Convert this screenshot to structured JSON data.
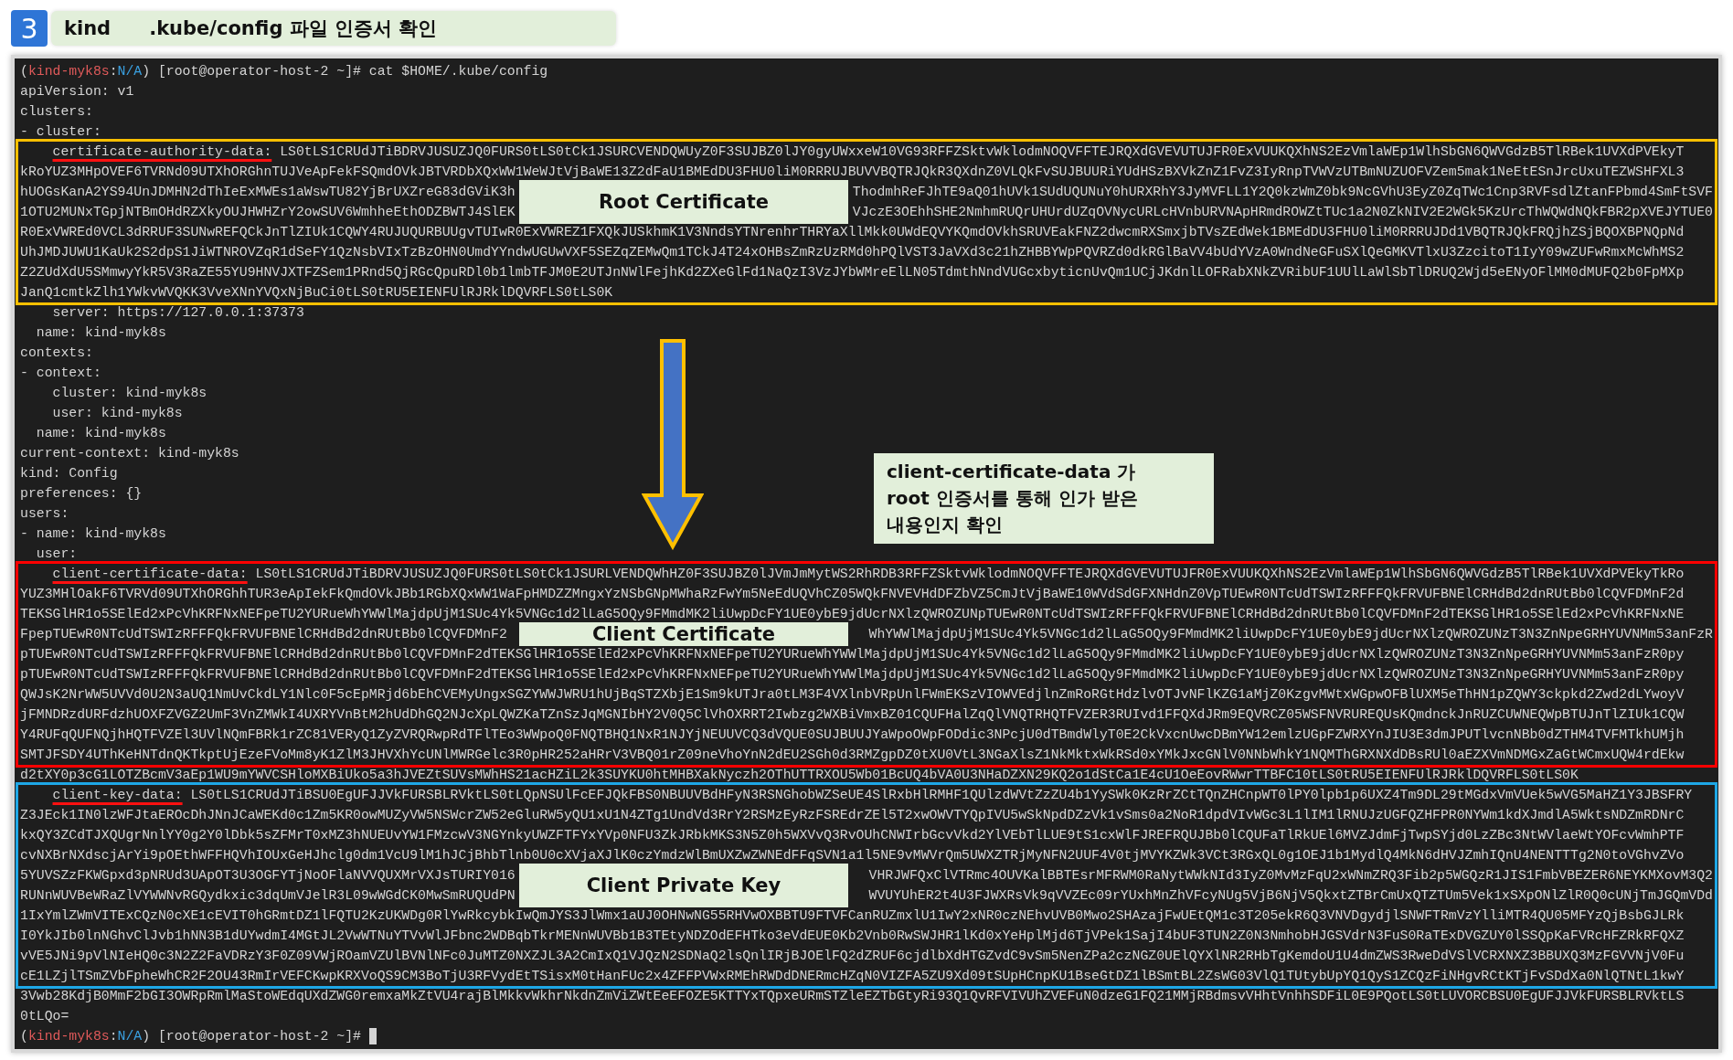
{
  "header": {
    "step": "3",
    "title_parts": [
      "kind",
      ".kube/config 파일 인증서 확인"
    ]
  },
  "terminal": {
    "sections": [
      {
        "kind": "plain",
        "lines": [
          {
            "kind": "prompt",
            "segments": [
              {
                "text": "(",
                "color": "#d4d4d4"
              },
              {
                "text": "kind-myk8s",
                "color": "#e05a5a"
              },
              {
                "text": ":",
                "color": "#d4d4d4"
              },
              {
                "text": "N/A",
                "color": "#3aa0e0"
              },
              {
                "text": ") [root@operator-host-2 ~]# cat $HOME/.kube/config",
                "color": "#d4d4d4"
              }
            ],
            "cursor": false
          },
          {
            "kind": "text",
            "text": "apiVersion: v1"
          },
          {
            "kind": "text",
            "text": "clusters:"
          },
          {
            "kind": "text",
            "text": "- cluster:"
          }
        ]
      },
      {
        "kind": "box",
        "color": "#ffc000",
        "label": "Root Certificate",
        "lines": [
          {
            "kind": "key",
            "key": "certificate-authority-data:",
            "value": "LS0tLS1CRUdJTiBDRVJUSUZJQ0FURS0tLS0tCk1JSURCVENDQWUyZ0F3SUJBZ0lJY0gyUWxxeW10VG93RFFZSktvWklodmNOQVFFTEJRQXdGVEVUTUJFR0ExVUUKQXhNS2EzVmlaWEp1WlhSbGN6QWVGdzB5TlRBek1UVXdPVEkyT"
          },
          {
            "kind": "text",
            "text": "kRoYUZ3MHpOVEF6TVRNd09UTXhORGhnTUJVeApFekFSQmdOVkJBTVRDbXQxWW1WeWJtVjBaWE13Z2dFaU1BMEdDU3FHU0liM0RRRUJBUVVBQTRJQkR3QXdnZ0VLQkFvSUJBUURiYUdHSzBXVkZnZ1FvZ3IyRnpTVWVzUTBmNUZUOFVZem5mak1NeEtESnJrcUxuTEZWSHFXL3"
          },
          {
            "kind": "split",
            "left": "hUOGsKanA2YS94UnJDMHN2dThIeExMWEs1aWswTU82YjBrUXZreG83dGViK3h",
            "right": "ThodmhReFJhTE9aQ01hUVk1SUdUQUNuY0hURXRhY3JyMVFLL1Y2Q0kzWmZ0bk9NcGVhU3EyZ0ZqTWc1Cnp3RVFsdlZtanFPbmd4SmFtSVF"
          },
          {
            "kind": "split",
            "left": "1OTU2MUNxTGpjNTBmOHdRZXkyOUJHWHZrY2owSUV6WmhheEthODZBWTJ4SlEK",
            "right": "VJczE3OEhhSHE2NmhmRUQrUHUrdUZqOVNycURLcHVnbURVNApHRmdROWZtTUc1a2N0ZkNIV2E2WGk5KzUrcThWQWdNQkFBR2pXVEJYTUE0"
          },
          {
            "kind": "text",
            "text": "R0ExVWREd0VCL3dRRUF3SUNwREFQCkJnTlZIUk1CQWY4RUJUQURBUUgvTUIwR0ExVWREZ1FXQkJUSkhmK1V3NndsYTNrenhrTHRYaXllMkk0UWdEQVYKQmdOVkhSRUVEakFNZ2dwcmRXSmxjbTVsZEdWek1BMEdDU3FHU0liM0RRRUJDd1VBQTRJQkFRQjhZSjBQOXBPNQpNd"
          },
          {
            "kind": "text",
            "text": "UhJMDJUWU1KaUk2S2dpS1JiWTNROVZqR1dSeFY1QzNsbVIxTzBzOHN0UmdYYndwUGUwVXF5SEZqZEMwQm1TCkJ4T24xOHBsZmRzUzRMd0hPQlVST3JaVXd3c21hZHBBYWpPQVRZd0dkRGlBaVV4bUdYVzA0WndNeGFuSXlQeGMKVTlxU3ZzcitoT1IyY09wZUFwRmxMcWhMS2"
          },
          {
            "kind": "text",
            "text": "Z2ZUdXdU5SMmwyYkR5V3RaZE55YU9HNVJXTFZSem1PRnd5QjRGcQpuRDl0b1lmbTFJM0E2UTJnNWlFejhKd2ZXeGlFd1NaQzI3VzJYbWMreElLN05TdmthNndVUGcxbyticnUvQm1UCjJKdnlLOFRabXNkZVRibUF1UUlLaWlSbTlDRUQ2Wjd5eENyOFlMM0dMUFQ2b0FpMXp"
          },
          {
            "kind": "text",
            "text": "JanQ1cmtkZlh1YWkvWVQKK3VveXNnYVQxNjBuCi0tLS0tRU5EIENFUlRJRklDQVRFLS0tLS0K"
          }
        ]
      },
      {
        "kind": "plain",
        "lines": [
          {
            "kind": "text",
            "text": "    server: https://127.0.0.1:37373"
          },
          {
            "kind": "text",
            "text": "  name: kind-myk8s"
          },
          {
            "kind": "text",
            "text": "contexts:"
          },
          {
            "kind": "text",
            "text": "- context:"
          },
          {
            "kind": "text",
            "text": "    cluster: kind-myk8s"
          },
          {
            "kind": "text",
            "text": "    user: kind-myk8s"
          },
          {
            "kind": "text",
            "text": "  name: kind-myk8s"
          },
          {
            "kind": "text",
            "text": "current-context: kind-myk8s"
          },
          {
            "kind": "text",
            "text": "kind: Config"
          },
          {
            "kind": "text",
            "text": "preferences: {}"
          },
          {
            "kind": "text",
            "text": "users:"
          },
          {
            "kind": "text",
            "text": "- name: kind-myk8s"
          },
          {
            "kind": "text",
            "text": "  user:"
          }
        ]
      },
      {
        "kind": "box",
        "color": "#ff0000",
        "label": "Client Certificate",
        "lines": [
          {
            "kind": "key",
            "key": "client-certificate-data:",
            "value": "LS0tLS1CRUdJTiBDRVJUSUZJQ0FURS0tLS0tCk1JSURLVENDQWhHZ0F3SUJBZ0lJVmJmMytWS2RhRDB3RFFZSktvWklodmNOQVFFTEJRQXdGVEVUTUJFR0ExVUUKQXhNS2EzVmlaWEp1WlhSbGN6QWVGdzB5TlRBek1UVXdPVEkyTkRo"
          },
          {
            "kind": "text",
            "text": "YUZ3MHlOakF6TVRVd09UTXhORGhhTUR3eApIekFkQmdOVkJBb1RGbXQxWW1WaFpHMDZZMngxYzNSbGNpMWhaRzFwYm5NeEdUQVhCZ05WQkFNVEVHdDFZbVZ5CmJtVjBaWE10WVdSdGFXNHdnZ0VpTUEwR0NTcUdTSWIzRFFFQkFRVUFBNElCRHdBd2dnRUtBb0lCQVFDMnF2d"
          },
          {
            "kind": "text",
            "text": "TEKSGlHR1o5SElEd2xPcVhKRFNxNEFpeTU2YURueWhYWWlMajdpUjM1SUc4Yk5VNGc1d2lLaG5OQy9FMmdMK2liUwpDcFY1UE0ybE9jdUcrNXlzQWROZUNpTUEwR0NTcUdTSWIzRFFFQkFRVUFBNElCRHdBd2dnRUtBb0lCQVFDMnF2dTEKSGlHR1o5SElEd2xPcVhKRFNxNE"
          },
          {
            "kind": "split",
            "left": "FpepTUEwR0NTcUdTSWIzRFFFQkFRVUFBNElCRHdBd2dnRUtBb0lCQVFDMnF2",
            "right": "WhYWWlMajdpUjM1SUc4Yk5VNGc1d2lLaG5OQy9FMmdMK2liUwpDcFY1UE0ybE9jdUcrNXlzQWROZUNzT3N3ZnNpeGRHYUVNMm53anFzR"
          },
          {
            "kind": "text",
            "text": "pTUEwR0NTcUdTSWIzRFFFQkFRVUFBNElCRHdBd2dnRUtBb0lCQVFDMnF2dTEKSGlHR1o5SElEd2xPcVhKRFNxNEFpeTU2YURueWhYWWlMajdpUjM1SUc4Yk5VNGc1d2lLaG5OQy9FMmdMK2liUwpDcFY1UE0ybE9jdUcrNXlzQWROZUNzT3N3ZnNpeGRHYUVNMm53anFzR0py"
          },
          {
            "kind": "text",
            "text": "pTUEwR0NTcUdTSWIzRFFFQkFRVUFBNElCRHdBd2dnRUtBb0lCQVFDMnF2dTEKSGlHR1o5SElEd2xPcVhKRFNxNEFpeTU2YURueWhYWWlMajdpUjM1SUc4Yk5VNGc1d2lLaG5OQy9FMmdMK2liUwpDcFY1UE0ybE9jdUcrNXlzQWROZUNzT3N3ZnNpeGRHYUVNMm53anFzR0py"
          },
          {
            "kind": "text",
            "text": "QWJsK2NrWW5UVVd0U2N3aUQ1NmUvCkdLY1Nlc0F5cEpMRjd6bEhCVEMyUngxSGZYWWJWRU1hUjBqSTZXbjE1Sm9kUTJra0tLM3F4VXlnbVRpUnlFWmEKSzVIOWVEdjlnZmRoRGtHdzlvOTJvNFlKZG1aMjZ0KzgvMWtxWGpwOFBlUXM5eThHN1pZQWY3ckpkd2Zwd2dLYwoyV"
          },
          {
            "kind": "text",
            "text": "jFMNDRzdURFdzhUOXFZVGZ2UmF3VnZMWkI4UXRYVnBtM2hUdDhGQ2NJcXpLQWZKaTZnSzJqMGNIbHY2V0Q5ClVhOXRRT2Iwbzg2WXBiVmxBZ01CQUFHalZqQlVNQTRHQTFVZER3RUIvd1FFQXdJRm9EQVRCZ05WSFNVRUREQUsKQmdnckJnRUZCUWNEQWpBTUJnTlZIUk1CQW"
          },
          {
            "kind": "text",
            "text": "Y4RUFqQUFNQjhHQTFVZEl3UVlNQmFBRk1rZC81VERyQ1ZyZVRQRwpRdTFlTEo3WWpoQ0FNQTBHQ1NxR1NJYjNEUUVCQ3dVQUE0SUJBUUJYaWpoOWpFODdic3NPcjU0dTBmdWlyT0E2CkVxcnUwcDBmYW12emlzUGpFZWRXYnJIU3E3dmJPUTlvcnNBb0dZTHM4TVFMTkhUMjh"
          },
          {
            "kind": "text",
            "text": "SMTJFSDY4UThKeHNTdnQKTkptUjEzeFVoMm8yK1ZlM3JHVXhYcUNlMWRGelc3R0pHR252aHRrV3VBQ01rZ09neVhoYnN2dEU2SGh0d3RMZgpDZ0tXU0VtL3NGaXlsZ1NkMktxWkRSd0xYMkJxcGNlV0NNbWhkY1NQMThGRXNXdDBsRUl0aEZXVmNDMGxZaGtWCmxUQW4rdEkw"
          }
        ]
      },
      {
        "kind": "plain",
        "lines": [
          {
            "kind": "text",
            "text": "d2tXY0p3cG1LOTZBcmV3aEp1WU9mYWVCSHloMXBiUko5a3hJVEZtSUVsMWhHS21acHZiL2k3SUYKU0htMHBXakNyczh2OThUTTRXOU5Wb01BcUQ4bVA0U3NHaDZXN29KQ2o1dStCa1E4cU1OeEovRWwrTTBFC10tLS0tRU5EIENFUlRJRklDQVRFLS0tLS0K"
          }
        ]
      },
      {
        "kind": "box",
        "color": "#1ea7e6",
        "label": "Client Private Key",
        "lines": [
          {
            "kind": "key",
            "key": "client-key-data:",
            "value": "LS0tLS1CRUdJTiBSU0EgUFJJVkFURSBLRVktLS0tLQpNSUlFcEFJQkFBS0NBUUVBdHFyN3RSNGhobWZSeUE4SlRxbHlRMHF1QUlzdWVtZzZU4b1YySWk0KzRrZCtTQnZHCnpWT0lPY0lpb1p6UXZ4Tm9DL29tMGdxVmVUek5wVG5MaHZ1Y3JBSFRY"
          },
          {
            "kind": "text",
            "text": "Z3JEck1IN0lzWFJtaEROcDhJNnJCaWEKd0c1Zm5KR0owMUZyVW5NSWcrZW52eGluRW5yQU1xU1N4ZTg1UndVd3RrY2RSMzEyRzFSREdrZEl5T2xwOWVTYQpIVU5wSkNpdDZzVk1vSms0a2NoR1dpdVIvWGc3L1lIM1lRNUJzUGFQZHFPR0NYWm1kdXJmdlA5WktsNDZmRDNrC"
          },
          {
            "kind": "text",
            "text": "kxQY3ZCdTJXQUgrNnlYY0g2Y0lDbk5sZFMrT0xMZ3hNUEUvYW1FMzcwV3NGYnkyUWZFTFYxYVp0NFU3ZkJRbkMKS3N5Z0h5WXVvQ3RvOUhCNWIrbGcvVkd2YlVEbTlLUE9tS1cxWlFJREFRQUJBb0lCQUFaTlRkUEl6MVZJdmFjTwpSYjd0LzZBc3NtWVlaeWtYOFcvWmhPTF"
          },
          {
            "kind": "text",
            "text": "cvNXBrNXdscjArYi9pOEthWFFHQVhIOUxGeHJhclg0dm1VcU9lM1hJCjBhbTlnb0U0cXVjaXJlK0czYmdzWlBmUXZwZWNEdFFqSVN1a1l5NE9vMWVrQm5UWXZTRjMyNFN2UUF4V0tjMVYKZWk3VCt3RGxQL0g1OEJ1b1MydlQ4MkN6dHVJZmhIQnU4NENTTTg2N0toVGhvZVo"
          },
          {
            "kind": "split",
            "left": "5YUVSZzFKWGpxd3pNRUd3UApOT3U3OGFYTjNoOFlaNVVQUXMrVXJsTURIY016",
            "right": "VHRJWFQxClVTRmc4OUVKalBBTEsrMFRWM0RaNytWWkNId3IyZ0MvMzFqU2xWNmZRQ3Fib2p5WGQzR1JIS1FmbVBEZER6NEYKMXovM3Q2"
          },
          {
            "kind": "split",
            "left": "RUNnWUVBeWRaZlVYWWNvRGQydkxic3dqUmVJelR3L09wWGdCK0MwSmRUQUdPN",
            "right": "WVUYUhER2t4U3FJWXRsVk9qVVZEc09rYUxhMnZhVFcyNUg5VjB6NjV5QkxtZTBrCmUxQTZTUm5Vek1xSXpONlZlR0Q0cUNjTmJGQmVDd"
          },
          {
            "kind": "text",
            "text": "1IxYmlZWmVITExCQzN0cXE1cEVIT0hGRmtDZ1lFQTU2KzUKWDg0RlYwRkcybkIwQmJYS3JlWmx1aUJ0OHNwNG55RHVwOXBBTU9FTVFCanRUZmxlU1IwY2xNR0czNEhvUVB0Mwo2SHAzajFwUEtQM1c3T205ekR6Q3VNVDgydjlSNWFTRmVzYlliMTR4QU05MFYzQjBsbGJLRk"
          },
          {
            "kind": "text",
            "text": "I0YkJIb0lnNGhvClJvb1hNN3B1dUYwdmI4MGtJL2VwWTNuYTVvWlJFbnc2WDBqbTkrMENnWUVBb1B3TEtyNDZOdEFHTko3eVdEUE0Kb2Vnb0RwSWJHR1lKd0xYeHplMjd6TjVPek1SajI4bUF3TUN2Z0N3NmhobHJGSVdrN3FuS0RaTExDVGZUY0lSSQpKaFVRcHFZRkRFQXZ"
          },
          {
            "kind": "text",
            "text": "vVE5JNi9pVlNIeHQ0c3N2Z2FaVDRzY3F0Z09VWjROamVZUlBVNlNFc0JuMTZ0NXZJL3A2CmIxQ1VJQzN2SDNaQ2lsQnlIRjBJOElFQ2dZRUF6cjdlbXdHTGZvdC9vSm5NenZPa2czNGZ0UElQYXlNR2RHbTgKemdoU1U4dmZWS3RweDdVSlVCRXNXZ3BBUXQ3MzFGVVNjV0Fu"
          },
          {
            "kind": "text",
            "text": "cE1LZjlTSmZVbFpheWhCR2F2OU43RmIrVEFCKwpKRXVoQS9CM3BoTjU3RFVydEtTSisxM0tHanFUc2x4ZFFPVWxRMEhRWDdDNERmcHZqN0VIZFA5ZU9Xd09tSUpHCnpKU1BseGtDZ1lBSmtBL2ZsWG03VlQ1TUtybUpYQ1QyS1ZCQzFiNHgvRCtKTjFvSDdXa0NlQTNtL1kwY"
          }
        ]
      },
      {
        "kind": "plain",
        "lines": [
          {
            "kind": "text",
            "text": "3Vwb28KdjB0MmF2bGI3OWRpRmlMaStoWEdqUXdZWG0remxaMkZtVU4rajBlMkkvWkhrNkdnZmViZWtEeEFOZE5KTTYxTQpxeURmSTZleEZTbGtyRi93Q1QvRFVIVUhZVEFuN0dzeG1FQ21MMjRBdmsvVHhtVnhhSDFiL0E9PQotLS0tLUVORCBSU0EgUFJJVkFURSBLRVktLS"
          },
          {
            "kind": "text",
            "text": "0tLQo="
          },
          {
            "kind": "prompt",
            "segments": [
              {
                "text": "(",
                "color": "#d4d4d4"
              },
              {
                "text": "kind-myk8s",
                "color": "#e05a5a"
              },
              {
                "text": ":",
                "color": "#d4d4d4"
              },
              {
                "text": "N/A",
                "color": "#3aa0e0"
              },
              {
                "text": ") [root@operator-host-2 ~]#",
                "color": "#d4d4d4"
              }
            ],
            "cursor": true
          }
        ]
      }
    ],
    "callout": {
      "lines": [
        "client-certificate-data 가",
        "root 인증서를 통해 인가 받은",
        "내용인지 확인"
      ]
    }
  }
}
